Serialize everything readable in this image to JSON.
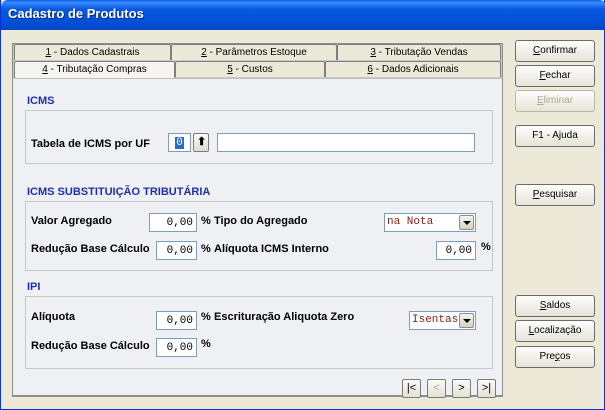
{
  "window": {
    "title": "Cadastro de Produtos"
  },
  "tabs": {
    "row1": [
      {
        "num": "1",
        "text": " - Dados Cadastrais"
      },
      {
        "num": "2",
        "text": " - Parâmetros Estoque"
      },
      {
        "num": "3",
        "text": " - Tributação Vendas"
      }
    ],
    "row2": [
      {
        "num": "4",
        "text": " - Tributação Compras"
      },
      {
        "num": "5",
        "text": " - Custos"
      },
      {
        "num": "6",
        "text": " - Dados Adicionais"
      }
    ]
  },
  "icms": {
    "title": "ICMS",
    "uf_label": "Tabela de ICMS por UF",
    "uf_value": "0",
    "uf_desc": ""
  },
  "icms_st": {
    "title": "ICMS SUBSTITUIÇÃO TRIBUTÁRIA",
    "valor_agregado_label": "Valor Agregado",
    "valor_agregado_value": "0,00",
    "tipo_agregado_label": "Tipo do Agregado",
    "tipo_agregado_value": "na Nota",
    "reducao_label": "Redução Base Cálculo",
    "reducao_value": "0,00",
    "aliquota_interno_label": "Alíquota ICMS Interno",
    "aliquota_interno_value": "0,00",
    "pct": "%"
  },
  "ipi": {
    "title": "IPI",
    "aliquota_label": "Alíquota",
    "aliquota_value": "0,00",
    "escrituracao_label": "Escrituração Aliquota Zero",
    "escrituracao_value": "Isentas",
    "reducao_label": "Redução Base Cálculo",
    "reducao_value": "0,00",
    "pct": "%"
  },
  "buttons": {
    "confirmar": {
      "ul": "C",
      "rest": "onfirmar"
    },
    "fechar": {
      "ul": "F",
      "rest": "echar"
    },
    "eliminar": {
      "ul": "E",
      "rest": "liminar"
    },
    "ajuda": "F1 - Ajuda",
    "pesquisar": {
      "ul": "P",
      "rest": "esquisar"
    },
    "saldos": {
      "ul": "S",
      "rest": "aldos"
    },
    "localizacao": {
      "pre": "",
      "ul": "L",
      "rest": "ocalização"
    },
    "precos": {
      "pre": "Pre",
      "ul": "ç",
      "rest": "os"
    }
  },
  "nav": {
    "first": "|<",
    "prev": "<",
    "next": ">",
    "last": ">|"
  }
}
